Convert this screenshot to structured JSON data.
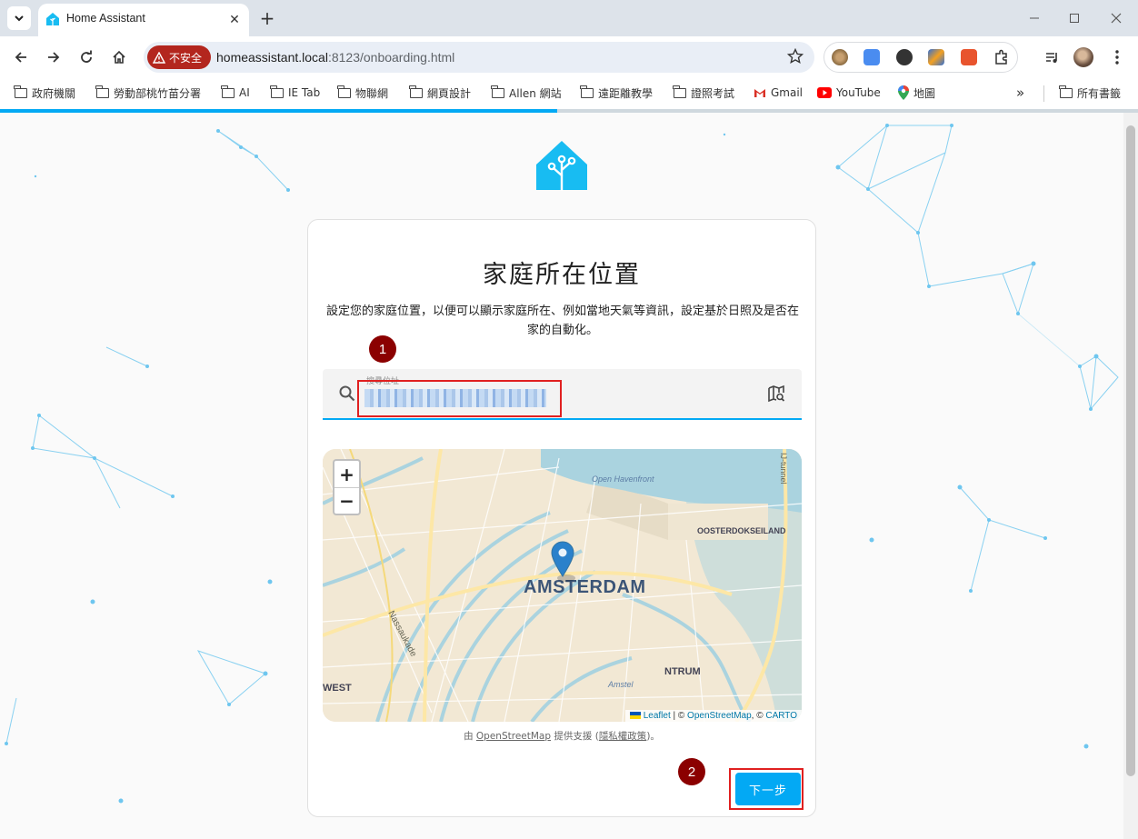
{
  "browser": {
    "tab_title": "Home Assistant",
    "security_label": "不安全",
    "url_host": "homeassistant.local",
    "url_path": ":8123/onboarding.html"
  },
  "bookmarks": [
    {
      "label": "政府機關",
      "icon": "folder-icon"
    },
    {
      "label": "勞動部桃竹苗分署",
      "icon": "folder-icon"
    },
    {
      "label": "AI",
      "icon": "folder-icon"
    },
    {
      "label": "IE Tab",
      "icon": "folder-icon"
    },
    {
      "label": "物聯網",
      "icon": "folder-icon"
    },
    {
      "label": "網頁設計",
      "icon": "folder-icon"
    },
    {
      "label": "Allen 網站",
      "icon": "folder-icon"
    },
    {
      "label": "遠距離教學",
      "icon": "folder-icon"
    },
    {
      "label": "證照考試",
      "icon": "folder-icon"
    },
    {
      "label": "Gmail",
      "icon": "gmail-icon"
    },
    {
      "label": "YouTube",
      "icon": "youtube-icon"
    },
    {
      "label": "地圖",
      "icon": "maps-icon"
    }
  ],
  "bookmarks_overflow": "»",
  "all_bookmarks": "所有書籤",
  "onboarding_progress": 0.49,
  "colors": {
    "primary": "#03a9f4",
    "annotation_red": "#e02020",
    "annotation_badge": "#8b0000"
  },
  "card": {
    "title": "家庭所在位置",
    "description": "設定您的家庭位置，以便可以顯示家庭所在、例如當地天氣等資訊，設定基於日照及是否在家的自動化。",
    "search_label": "搜尋位址",
    "powered_prefix": "由 ",
    "powered_link": "OpenStreetMap",
    "powered_mid": " 提供支援 (",
    "privacy_link": "隱私權政策",
    "powered_suffix": ")。",
    "next_button": "下一步"
  },
  "map": {
    "zoom_in": "+",
    "zoom_out": "−",
    "city_label": "AMSTERDAM",
    "place_labels": [
      "Open Havenfront",
      "OOSTERDOKSEILAND",
      "Nassaukade",
      "WEST",
      "NTRUM",
      "IJ-tunnel",
      "Amstel"
    ],
    "attribution_leaflet": "Leaflet",
    "attribution_sep1": " | © ",
    "attribution_osm": "OpenStreetMap",
    "attribution_sep2": ", © ",
    "attribution_carto": "CARTO"
  },
  "annotations": [
    "1",
    "2"
  ]
}
